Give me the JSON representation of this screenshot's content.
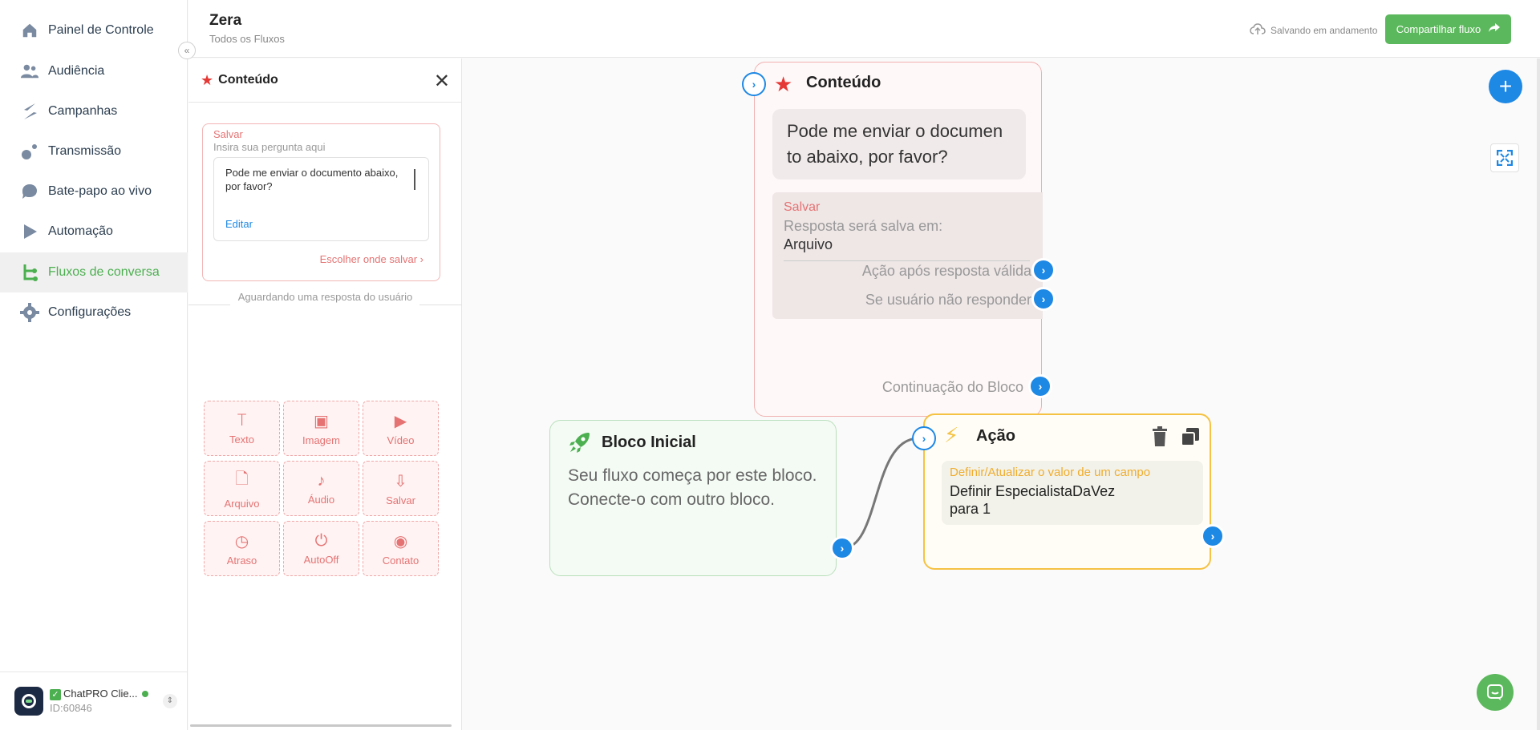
{
  "nav": {
    "items": [
      {
        "label": "Painel de Controle",
        "icon": "home-icon"
      },
      {
        "label": "Audiência",
        "icon": "users-icon"
      },
      {
        "label": "Campanhas",
        "icon": "campaign-icon"
      },
      {
        "label": "Transmissão",
        "icon": "broadcast-icon"
      },
      {
        "label": "Bate-papo ao vivo",
        "icon": "chat-bubble-icon"
      },
      {
        "label": "Automação",
        "icon": "play-icon"
      },
      {
        "label": "Fluxos de conversa",
        "icon": "flow-icon"
      },
      {
        "label": "Configurações",
        "icon": "gear-icon"
      }
    ],
    "active": "Fluxos de conversa",
    "collapse_label": "«",
    "account": {
      "name": "ChatPRO Clie...",
      "id": "ID:60846"
    }
  },
  "header": {
    "title": "Zera",
    "subtitle": "Todos os Fluxos",
    "save_status": "Salvando em andamento",
    "share_label": "Compartilhar fluxo"
  },
  "panel": {
    "title": "Conteúdo",
    "save_title": "Salvar",
    "question_placeholder": "Insira sua pergunta aqui",
    "message": "Pode me enviar o documento abaixo, por favor?",
    "edit_label": "Editar",
    "choose_save": "Escolher onde salvar",
    "waiting": "Aguardando uma resposta do usuário",
    "tiles": [
      {
        "label": "Texto",
        "icon": "text-icon"
      },
      {
        "label": "Imagem",
        "icon": "image-icon"
      },
      {
        "label": "Vídeo",
        "icon": "video-icon"
      },
      {
        "label": "Arquivo",
        "icon": "file-icon"
      },
      {
        "label": "Áudio",
        "icon": "audio-icon"
      },
      {
        "label": "Salvar",
        "icon": "download-icon"
      },
      {
        "label": "Atraso",
        "icon": "clock-icon"
      },
      {
        "label": "AutoOff",
        "icon": "power-icon"
      },
      {
        "label": "Contato",
        "icon": "contact-icon"
      }
    ]
  },
  "canvas": {
    "content_node": {
      "title": "Conteúdo",
      "message": "Pode me enviar o documen to abaixo, por favor?",
      "save_title": "Salvar",
      "save_sub": "Resposta será salva em:",
      "save_value": "Arquivo",
      "valid_action": "Ação após resposta válida",
      "no_response": "Se usuário não responder",
      "continuation": "Continuação do Bloco"
    },
    "start_node": {
      "title": "Bloco Inicial",
      "text": "Seu fluxo começa por este bloco. Conecte-o com outro bloco."
    },
    "action_node": {
      "title": "Ação",
      "box_title": "Definir/Atualizar o valor de um campo",
      "box_line1": "Definir EspecialistaDaVez",
      "box_line2": "para 1"
    },
    "colors": {
      "accent": "#1e88e5",
      "brand": "#5cb85c",
      "content": "#e57373",
      "action": "#f5c243"
    }
  }
}
